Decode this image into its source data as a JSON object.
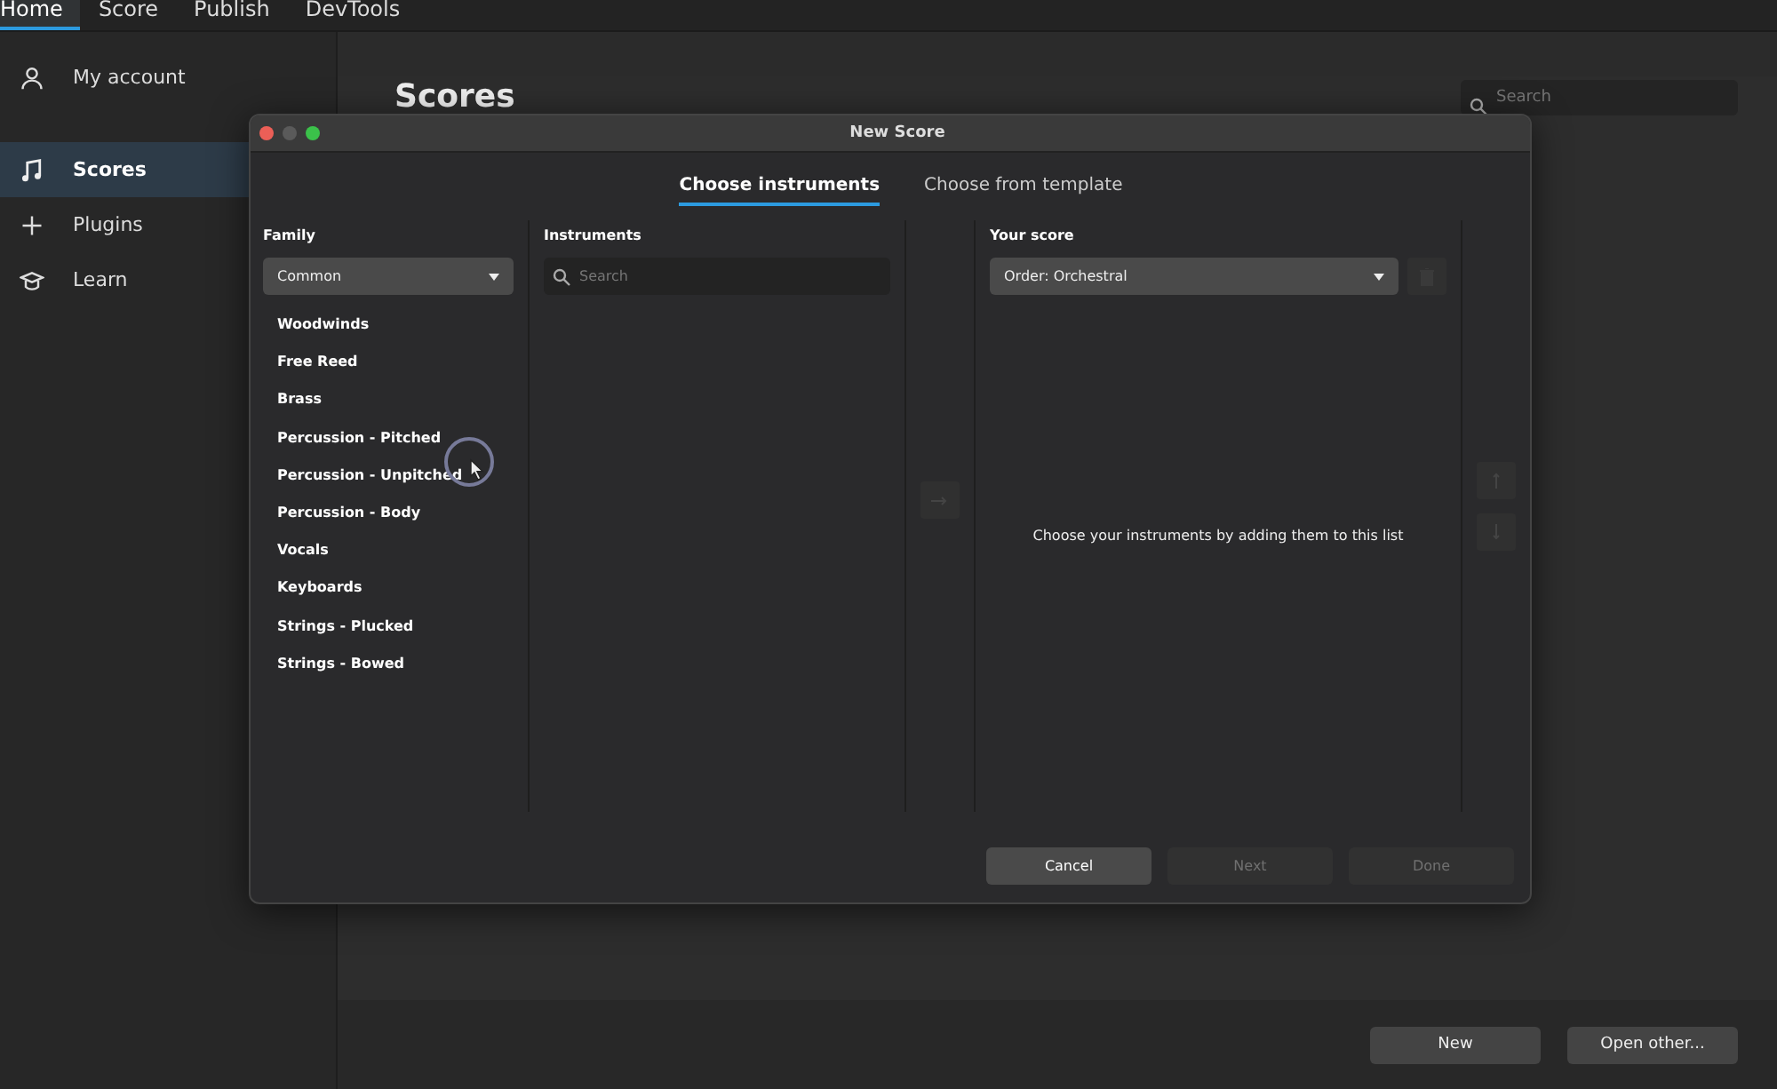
{
  "top_tabs": [
    {
      "label": "Home",
      "selected": true
    },
    {
      "label": "Score",
      "selected": false
    },
    {
      "label": "Publish",
      "selected": false
    },
    {
      "label": "DevTools",
      "selected": false
    }
  ],
  "sidebar": {
    "items": [
      {
        "label": "My account",
        "selected": false
      },
      {
        "label": "Scores",
        "selected": true
      },
      {
        "label": "Plugins",
        "selected": false
      },
      {
        "label": "Learn",
        "selected": false
      }
    ]
  },
  "main": {
    "title": "Scores",
    "search": {
      "placeholder": "Search"
    },
    "buttons": [
      "New",
      "Open other..."
    ]
  },
  "dialog": {
    "title": "New Score",
    "tabs": [
      {
        "label": "Choose instruments",
        "selected": true
      },
      {
        "label": "Choose from template",
        "selected": false
      }
    ],
    "family": {
      "heading": "Family",
      "dropdown": "Common",
      "items": [
        "Woodwinds",
        "Free Reed",
        "Brass",
        "Percussion - Pitched",
        "Percussion - Unpitched",
        "Percussion - Body",
        "Vocals",
        "Keyboards",
        "Strings - Plucked",
        "Strings - Bowed"
      ]
    },
    "instruments": {
      "heading": "Instruments",
      "search": {
        "placeholder": "Search"
      }
    },
    "your_score": {
      "heading": "Your score",
      "dropdown": "Order: Orchestral",
      "empty_message": "Choose your instruments by adding them to this list"
    },
    "buttons": [
      {
        "label": "Cancel",
        "disabled": false
      },
      {
        "label": "Next",
        "disabled": true
      },
      {
        "label": "Done",
        "disabled": true
      }
    ]
  }
}
